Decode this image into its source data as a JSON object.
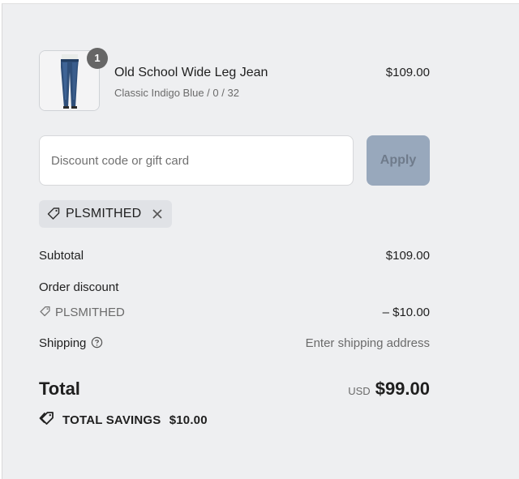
{
  "product": {
    "quantity": "1",
    "name": "Old School Wide Leg Jean",
    "variant": "Classic Indigo Blue / 0 / 32",
    "price": "$109.00"
  },
  "discount": {
    "placeholder": "Discount code or gift card",
    "apply_label": "Apply",
    "applied_code": "PLSMITHED"
  },
  "summary": {
    "subtotal_label": "Subtotal",
    "subtotal_value": "$109.00",
    "order_discount_label": "Order discount",
    "discount_code": "PLSMITHED",
    "discount_value": "– $10.00",
    "shipping_label": "Shipping",
    "shipping_value": "Enter shipping address",
    "total_label": "Total",
    "currency": "USD",
    "total_value": "$99.00",
    "savings_label": "TOTAL SAVINGS",
    "savings_value": "$10.00"
  },
  "colors": {
    "panel_bg": "#eeeff1",
    "apply_bg": "#98a8bc",
    "chip_bg": "#e0e2e6"
  }
}
